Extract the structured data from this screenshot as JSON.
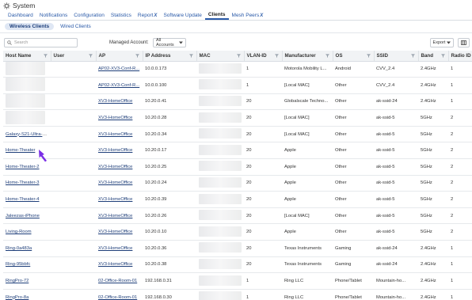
{
  "app": {
    "title": "System"
  },
  "nav": {
    "tabs": [
      {
        "label": "Dashboard"
      },
      {
        "label": "Notifications"
      },
      {
        "label": "Configuration"
      },
      {
        "label": "Statistics"
      },
      {
        "label": "Report",
        "ext": "X"
      },
      {
        "label": "Software Update"
      },
      {
        "label": "Clients",
        "active": true
      },
      {
        "label": "Mesh Peers",
        "ext": "X"
      }
    ]
  },
  "subtabs": [
    {
      "label": "Wireless Clients",
      "active": true
    },
    {
      "label": "Wired Clients"
    }
  ],
  "toolbar": {
    "search_placeholder": "Search",
    "managed_label": "Managed Account:",
    "managed_value": "All Accounts",
    "export_label": "Export"
  },
  "table": {
    "columns": [
      "Host Name",
      "User",
      "AP",
      "IP Address",
      "MAC",
      "VLAN-ID",
      "Manufacturer",
      "OS",
      "SSID",
      "Band",
      "Radio ID"
    ],
    "rows": [
      {
        "host": "",
        "user": "",
        "ap": "AP02-XV3-Conf-R...",
        "ip": "10.0.0.173",
        "vlan": "1",
        "manufacturer": "Motorola Mobility L...",
        "os": "Android",
        "ssid": "CVV_2.4",
        "band": "2.4GHz",
        "radio": "1"
      },
      {
        "host": "",
        "user": "",
        "ap": "AP02-XV3-Conf-R...",
        "ip": "10.0.0.100",
        "vlan": "1",
        "manufacturer": "[Local MAC]",
        "os": "Other",
        "ssid": "CVV_2.4",
        "band": "2.4GHz",
        "radio": "1"
      },
      {
        "host": "",
        "user": "",
        "ap": "XV3-HomeOffice",
        "ip": "10.20.0.41",
        "vlan": "20",
        "manufacturer": "Globalscale Techno...",
        "os": "Other",
        "ssid": "ak-ssid-24",
        "band": "2.4GHz",
        "radio": "1"
      },
      {
        "host": "",
        "user": "",
        "ap": "XV3-HomeOffice",
        "ip": "10.20.0.28",
        "vlan": "20",
        "manufacturer": "[Local MAC]",
        "os": "Other",
        "ssid": "ak-ssid-5",
        "band": "5GHz",
        "radio": "2"
      },
      {
        "host": "Galaxy-S21-Ultra-5G",
        "user": "",
        "ap": "XV3-HomeOffice",
        "ip": "10.20.0.34",
        "vlan": "20",
        "manufacturer": "[Local MAC]",
        "os": "Other",
        "ssid": "ak-ssid-5",
        "band": "5GHz",
        "radio": "2"
      },
      {
        "host": "Home-Theater",
        "user": "",
        "ap": "XV3-HomeOffice",
        "ip": "10.20.0.17",
        "vlan": "20",
        "manufacturer": "Apple",
        "os": "Other",
        "ssid": "ak-ssid-5",
        "band": "5GHz",
        "radio": "2"
      },
      {
        "host": "Home-Theater-2",
        "user": "",
        "ap": "XV3-HomeOffice",
        "ip": "10.20.0.25",
        "vlan": "20",
        "manufacturer": "Apple",
        "os": "Other",
        "ssid": "ak-ssid-5",
        "band": "5GHz",
        "radio": "2"
      },
      {
        "host": "Home-Theater-3",
        "user": "",
        "ap": "XV3-HomeOffice",
        "ip": "10.20.0.24",
        "vlan": "20",
        "manufacturer": "Apple",
        "os": "Other",
        "ssid": "ak-ssid-5",
        "band": "5GHz",
        "radio": "2"
      },
      {
        "host": "Home-Theater-4",
        "user": "",
        "ap": "XV3-HomeOffice",
        "ip": "10.20.0.39",
        "vlan": "20",
        "manufacturer": "Apple",
        "os": "Other",
        "ssid": "ak-ssid-5",
        "band": "5GHz",
        "radio": "2"
      },
      {
        "host": "Jaleezas-iPhone",
        "user": "",
        "ap": "XV3-HomeOffice",
        "ip": "10.20.0.26",
        "vlan": "20",
        "manufacturer": "[Local MAC]",
        "os": "Other",
        "ssid": "ak-ssid-5",
        "band": "5GHz",
        "radio": "2"
      },
      {
        "host": "Living-Room",
        "user": "",
        "ap": "XV3-HomeOffice",
        "ip": "10.20.0.10",
        "vlan": "20",
        "manufacturer": "Apple",
        "os": "Other",
        "ssid": "ak-ssid-5",
        "band": "5GHz",
        "radio": "2"
      },
      {
        "host": "Ring-0a483a",
        "user": "",
        "ap": "XV3-HomeOffice",
        "ip": "10.20.0.36",
        "vlan": "20",
        "manufacturer": "Texas Instruments",
        "os": "Gaming",
        "ssid": "ak-ssid-24",
        "band": "2.4GHz",
        "radio": "1"
      },
      {
        "host": "Ring-95bbfc",
        "user": "",
        "ap": "XV3-HomeOffice",
        "ip": "10.20.0.38",
        "vlan": "20",
        "manufacturer": "Texas Instruments",
        "os": "Gaming",
        "ssid": "ak-ssid-24",
        "band": "2.4GHz",
        "radio": "1"
      },
      {
        "host": "RingPro-72",
        "user": "",
        "ap": "02-Office-Room-01",
        "ip": "192.168.0.31",
        "vlan": "1",
        "manufacturer": "Ring LLC",
        "os": "Phone/Tablet",
        "ssid": "Mountain-ho...",
        "band": "2.4GHz",
        "radio": "1"
      },
      {
        "host": "RingPro-8a",
        "user": "",
        "ap": "02-Office-Room-01",
        "ip": "192.168.0.30",
        "vlan": "1",
        "manufacturer": "Ring LLC",
        "os": "Phone/Tablet",
        "ssid": "Mountain-ho...",
        "band": "2.4GHz",
        "radio": "1"
      }
    ]
  },
  "colors": {
    "accent": "#2a5aa8",
    "link": "#1f3f7a",
    "cursor": "#7a2ee6",
    "header_bg": "#f1f3f5"
  }
}
